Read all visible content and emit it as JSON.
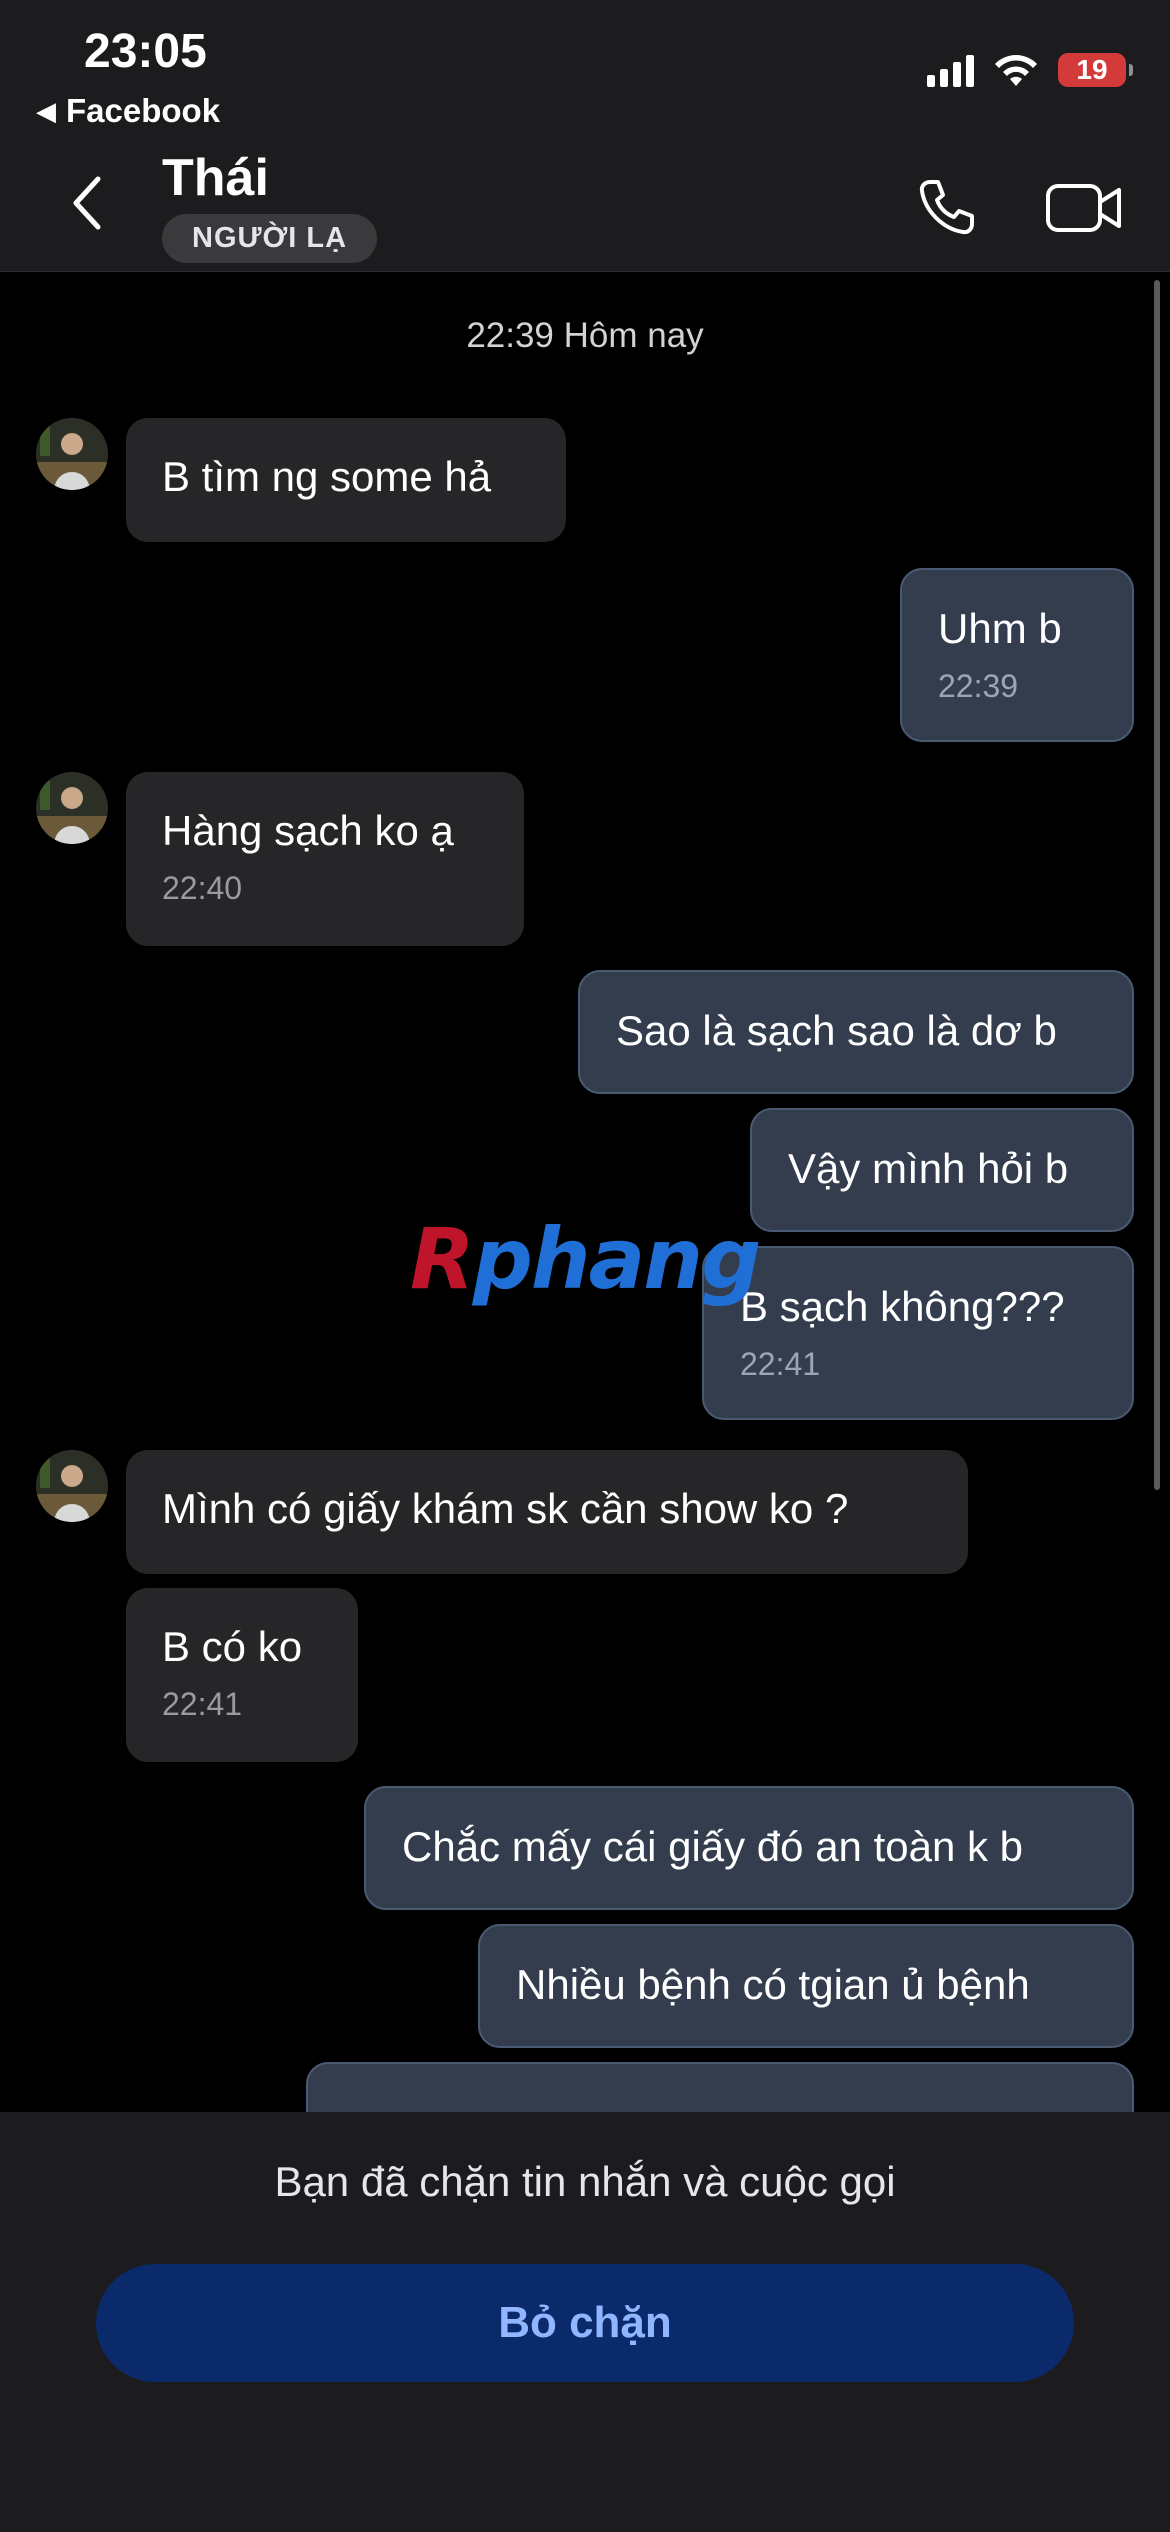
{
  "status_bar": {
    "time": "23:05",
    "back_app": "Facebook",
    "battery": "19",
    "icons": [
      "signal-icon",
      "wifi-icon",
      "battery-icon"
    ]
  },
  "header": {
    "name": "Thái",
    "badge": "NGƯỜI LẠ",
    "back_icon": "chevron-left-icon",
    "call_icon": "phone-icon",
    "video_icon": "video-camera-icon"
  },
  "chat": {
    "date_separator": "22:39 Hôm nay",
    "messages": [
      {
        "sender": "them",
        "text": "B tìm ng some hả",
        "time": ""
      },
      {
        "sender": "me",
        "text": "Uhm b",
        "time": "22:39"
      },
      {
        "sender": "them",
        "text": "Hàng sạch ko ạ",
        "time": "22:40"
      },
      {
        "sender": "me",
        "text": "Sao là sạch sao là dơ b",
        "time": ""
      },
      {
        "sender": "me",
        "text": "Vậy mình hỏi b",
        "time": ""
      },
      {
        "sender": "me",
        "text": "B sạch không???",
        "time": "22:41"
      },
      {
        "sender": "them",
        "text": "Mình có giấy khám sk cần show ko ?",
        "time": ""
      },
      {
        "sender": "them",
        "text": "B có ko",
        "time": "22:41"
      },
      {
        "sender": "me",
        "text": "Chắc mấy cái giấy đó an toàn k b",
        "time": ""
      },
      {
        "sender": "me",
        "text": "Nhiều bệnh có tgian ủ bệnh",
        "time": ""
      }
    ],
    "watermark": {
      "first": "R",
      "rest": "phang"
    }
  },
  "bottom": {
    "blocked_notice": "Bạn đã chặn tin nhắn và cuộc gọi",
    "unblock_label": "Bỏ chặn"
  }
}
